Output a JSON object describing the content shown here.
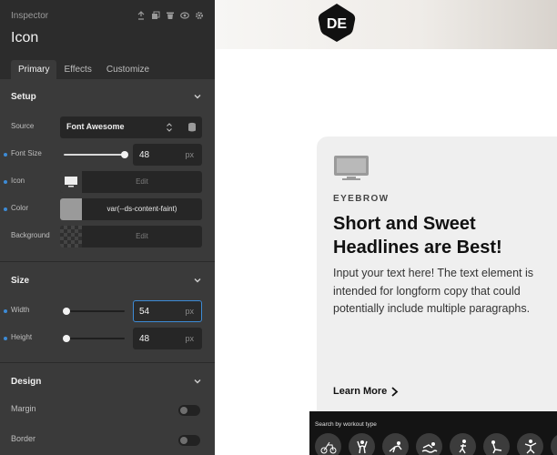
{
  "inspector": {
    "label": "Inspector",
    "title": "Icon",
    "tools": [
      "pin-icon",
      "copy-icon",
      "trash-icon",
      "eye-icon",
      "gear-icon"
    ],
    "tabs": [
      {
        "label": "Primary",
        "active": true
      },
      {
        "label": "Effects",
        "active": false
      },
      {
        "label": "Customize",
        "active": false
      }
    ],
    "setup": {
      "title": "Setup",
      "source": {
        "label": "Source",
        "value": "Font Awesome"
      },
      "font_size": {
        "label": "Font Size",
        "value": "48",
        "unit": "px",
        "level": 1.0
      },
      "icon": {
        "label": "Icon",
        "button": "Edit"
      },
      "color": {
        "label": "Color",
        "value": "var(--ds-content-faint)",
        "swatch": "#9a9a9a"
      },
      "background": {
        "label": "Background",
        "button": "Edit"
      }
    },
    "size": {
      "title": "Size",
      "width": {
        "label": "Width",
        "value": "54",
        "unit": "px",
        "level": 0.0
      },
      "height": {
        "label": "Height",
        "value": "48",
        "unit": "px",
        "level": 0.0
      }
    },
    "design": {
      "title": "Design",
      "margin": {
        "label": "Margin",
        "on": false
      },
      "border": {
        "label": "Border",
        "on": false
      }
    }
  },
  "canvas": {
    "logo_text": "DE",
    "card": {
      "eyebrow": "EYEBROW",
      "headline": "Short and Sweet Headlines are Best!",
      "body": "Input your text here! The text element is intended for longform copy that could potentially include multiple paragraphs.",
      "cta": "Learn More"
    },
    "workout": {
      "title": "Search by workout type",
      "icons": [
        "cycling-icon",
        "strength-icon",
        "yoga-icon",
        "swimming-icon",
        "running-icon",
        "stretching-icon",
        "dance-icon",
        "walking-icon"
      ]
    }
  },
  "colors": {
    "panel_bg": "#3a3a3a",
    "panel_header_bg": "#2c2c2c",
    "accent": "#3d8bd6",
    "card_bg": "#efefef"
  }
}
